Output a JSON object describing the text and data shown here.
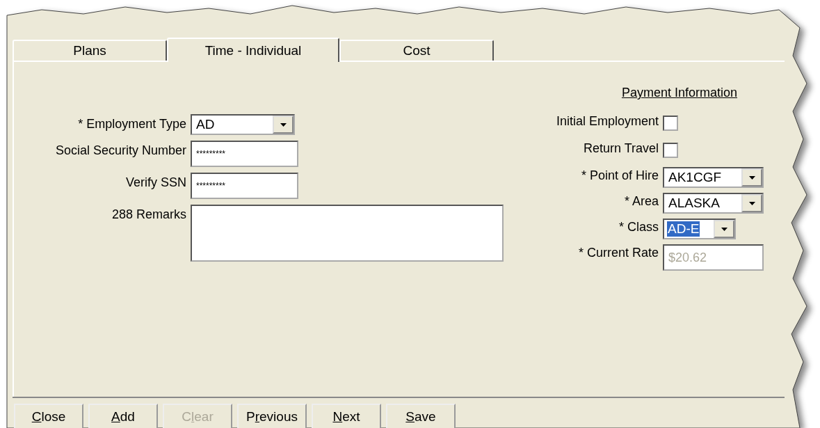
{
  "tabs": [
    {
      "label": "Plans",
      "selected": false
    },
    {
      "label": "Time - Individual",
      "selected": true
    },
    {
      "label": "Cost",
      "selected": false
    }
  ],
  "left_fields": [
    {
      "kind": "dropdown",
      "label": "* Employment Type",
      "value": "AD"
    },
    {
      "kind": "text",
      "label": "Social Security Number",
      "value": "*********"
    },
    {
      "kind": "text",
      "label": "Verify SSN",
      "value": "*********"
    },
    {
      "kind": "textarea",
      "label": "288 Remarks"
    }
  ],
  "payment": {
    "heading": "Payment Information",
    "fields": [
      {
        "kind": "checkbox",
        "label": "Initial Employment",
        "checked": false
      },
      {
        "kind": "checkbox",
        "label": "Return Travel",
        "checked": false
      },
      {
        "kind": "dropdown",
        "label": "* Point of Hire",
        "value": "AK1CGF",
        "highlighted": false
      },
      {
        "kind": "dropdown",
        "label": "* Area",
        "value": "ALASKA",
        "highlighted": false
      },
      {
        "kind": "smalldropdown",
        "label": "* Class",
        "value": "AD-E",
        "highlighted": true
      },
      {
        "kind": "text",
        "label": "* Current Rate",
        "value": "$20.62",
        "disabled": true
      }
    ]
  },
  "buttons": [
    {
      "key": "C",
      "after": "lose",
      "disabled": false
    },
    {
      "key": "A",
      "after": "dd",
      "disabled": false
    },
    {
      "before": "C",
      "key": "l",
      "after": "ear",
      "disabled": true
    },
    {
      "before": "P",
      "key": "r",
      "after": "evious",
      "disabled": false
    },
    {
      "key": "N",
      "after": "ext",
      "disabled": false
    },
    {
      "key": "S",
      "after": "ave",
      "disabled": false
    }
  ]
}
